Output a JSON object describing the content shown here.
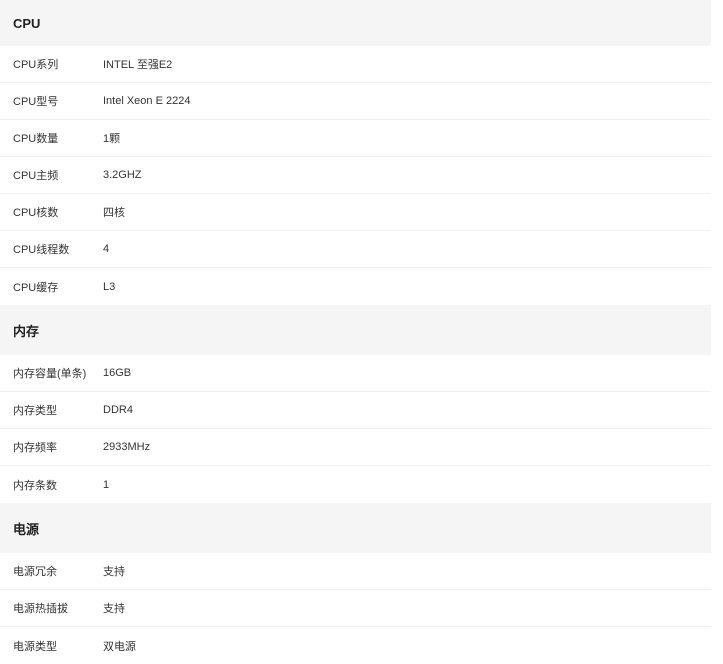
{
  "sections": [
    {
      "title": "CPU",
      "rows": [
        {
          "key": "CPU系列",
          "value": "INTEL 至强E2"
        },
        {
          "key": "CPU型号",
          "value": "Intel Xeon E 2224"
        },
        {
          "key": "CPU数量",
          "value": "1颗"
        },
        {
          "key": "CPU主频",
          "value": "3.2GHZ"
        },
        {
          "key": "CPU核数",
          "value": "四核"
        },
        {
          "key": "CPU线程数",
          "value": "4"
        },
        {
          "key": "CPU缓存",
          "value": "L3"
        }
      ]
    },
    {
      "title": "内存",
      "rows": [
        {
          "key": "内存容量(单条)",
          "value": "16GB"
        },
        {
          "key": "内存类型",
          "value": "DDR4"
        },
        {
          "key": "内存频率",
          "value": "2933MHz"
        },
        {
          "key": "内存条数",
          "value": "1"
        }
      ]
    },
    {
      "title": "电源",
      "rows": [
        {
          "key": "电源冗余",
          "value": "支持"
        },
        {
          "key": "电源热插拔",
          "value": "支持"
        },
        {
          "key": "电源类型",
          "value": "双电源"
        }
      ]
    }
  ]
}
